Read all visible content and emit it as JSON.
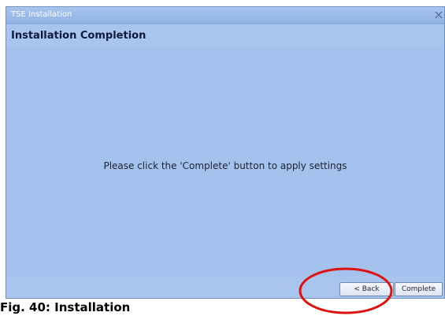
{
  "window": {
    "title": "TSE Installation",
    "close_glyph": "×"
  },
  "header": {
    "title": "Installation Completion"
  },
  "content": {
    "message": "Please click the 'Complete' button to apply settings"
  },
  "buttons": {
    "back_label": "< Back",
    "complete_label": "Complete"
  },
  "annotation": {
    "color": "#e01010"
  },
  "caption": {
    "text": "Fig. 40: Installation"
  },
  "colors": {
    "window_bg": "#a8c5ee",
    "title_text": "#ffffff",
    "header_text": "#0c1a38"
  }
}
